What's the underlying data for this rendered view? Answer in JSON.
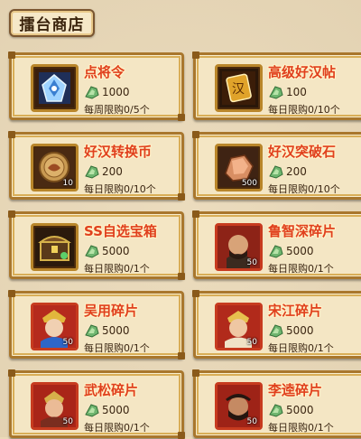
{
  "title": "擂台商店",
  "items": [
    {
      "name": "点将令",
      "price": "1000",
      "limit": "每周限购0/5个",
      "qty": "",
      "icon": "token-blue-icon"
    },
    {
      "name": "高级好汉帖",
      "price": "100",
      "limit": "每日限购0/10个",
      "qty": "",
      "icon": "gold-card-icon"
    },
    {
      "name": "好汉转换币",
      "price": "200",
      "limit": "每日限购0/10个",
      "qty": "10",
      "icon": "coin-icon"
    },
    {
      "name": "好汉突破石",
      "price": "200",
      "limit": "每日限购0/10个",
      "qty": "500",
      "icon": "stone-icon"
    },
    {
      "name": "SS自选宝箱",
      "price": "5000",
      "limit": "每日限购0/1个",
      "qty": "",
      "icon": "treasure-chest-icon"
    },
    {
      "name": "鲁智深碎片",
      "price": "5000",
      "limit": "每日限购0/1个",
      "qty": "50",
      "icon": "hero-portrait-icon"
    },
    {
      "name": "吴用碎片",
      "price": "5000",
      "limit": "每日限购0/1个",
      "qty": "50",
      "icon": "hero-portrait-icon"
    },
    {
      "name": "宋江碎片",
      "price": "5000",
      "limit": "每日限购0/1个",
      "qty": "50",
      "icon": "hero-portrait-icon"
    },
    {
      "name": "武松碎片",
      "price": "5000",
      "limit": "每日限购0/1个",
      "qty": "50",
      "icon": "hero-portrait-icon"
    },
    {
      "name": "李逵碎片",
      "price": "5000",
      "limit": "每日限购0/1个",
      "qty": "50",
      "icon": "hero-portrait-icon"
    }
  ]
}
